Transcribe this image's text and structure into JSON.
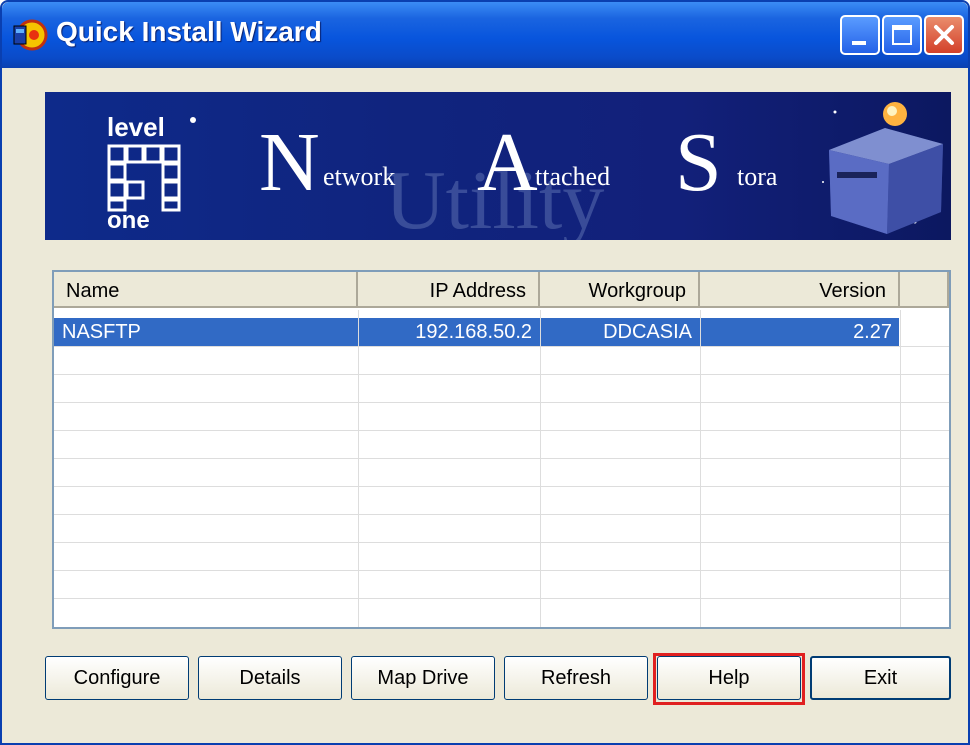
{
  "window": {
    "title": "Quick Install Wizard"
  },
  "titlebar": {
    "min_icon": "minimize-icon",
    "max_icon": "maximize-icon",
    "close_icon": "close-icon"
  },
  "banner": {
    "brand": "level one",
    "brand_top": "level",
    "brand_bottom": "one",
    "watermark": "Utility",
    "words": [
      {
        "letter": "N",
        "rest": "etwork"
      },
      {
        "letter": "A",
        "rest": "ttached"
      },
      {
        "letter": "S",
        "rest": "tora"
      }
    ]
  },
  "table": {
    "columns": [
      "Name",
      "IP Address",
      "Workgroup",
      "Version"
    ],
    "rows": [
      {
        "name": "NASFTP",
        "ip": "192.168.50.2",
        "workgroup": "DDCASIA",
        "version": "2.27",
        "selected": true
      }
    ]
  },
  "buttons": {
    "configure": "Configure",
    "details": "Details",
    "map_drive": "Map Drive",
    "refresh": "Refresh",
    "help": "Help",
    "exit": "Exit"
  },
  "colors": {
    "titlebar": "#0855dd",
    "selection": "#316ac5",
    "highlight": "#e02020",
    "banner": "#10247e"
  }
}
